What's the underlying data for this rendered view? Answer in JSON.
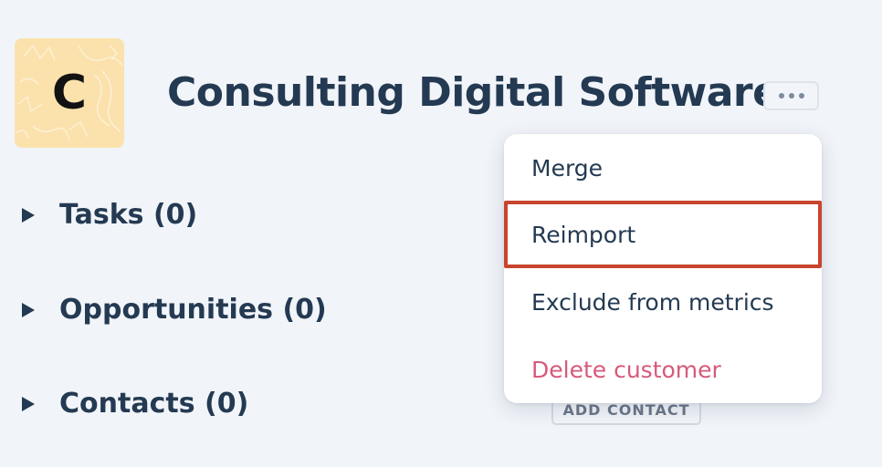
{
  "customer": {
    "avatar_letter": "C",
    "name": "Consulting Digital Software",
    "avatar_color": "#fbe2ad"
  },
  "header": {
    "more_icon": "ellipsis-icon"
  },
  "sections": [
    {
      "label": "Tasks (0)",
      "icon": "caret-right-icon"
    },
    {
      "label": "Opportunities (0)",
      "icon": "caret-right-icon"
    },
    {
      "label": "Contacts (0)",
      "icon": "caret-right-icon"
    }
  ],
  "contacts": {
    "add_label": "ADD CONTACT"
  },
  "menu": {
    "items": [
      {
        "label": "Merge"
      },
      {
        "label": "Reimport",
        "highlighted": true
      },
      {
        "label": "Exclude from metrics"
      },
      {
        "label": "Delete customer",
        "danger": true
      }
    ]
  },
  "colors": {
    "background": "#f1f4f9",
    "text": "#243a52",
    "danger": "#d75a7a",
    "highlight_border": "#c9442c"
  }
}
